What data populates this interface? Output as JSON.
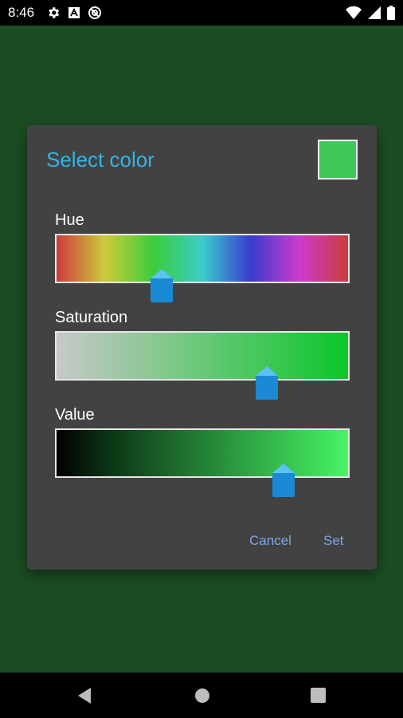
{
  "status_bar": {
    "time": "8:46",
    "left_icons": [
      "settings-icon",
      "a-badge-icon",
      "do-not-disturb-icon"
    ],
    "right_icons": [
      "wifi-icon",
      "signal-icon",
      "battery-icon"
    ]
  },
  "dialog": {
    "title": "Select color",
    "selected_color": "#3ec95a",
    "sliders": [
      {
        "label": "Hue",
        "level": 0.36
      },
      {
        "label": "Saturation",
        "level": 0.72
      },
      {
        "label": "Value",
        "level": 0.78
      }
    ],
    "cancel_label": "Cancel",
    "set_label": "Set"
  },
  "colors": {
    "accent": "#33b5e5",
    "thumb": "#1a8ad4",
    "app_background": "#1b4d23",
    "dialog_background": "#424242",
    "saturation_start": "#c8c8c8",
    "saturation_end": "#0ac729",
    "value_start": "#000000",
    "value_end": "#47f565"
  },
  "nav_bar": {
    "icons": [
      "back-icon",
      "home-icon",
      "recents-icon"
    ]
  }
}
